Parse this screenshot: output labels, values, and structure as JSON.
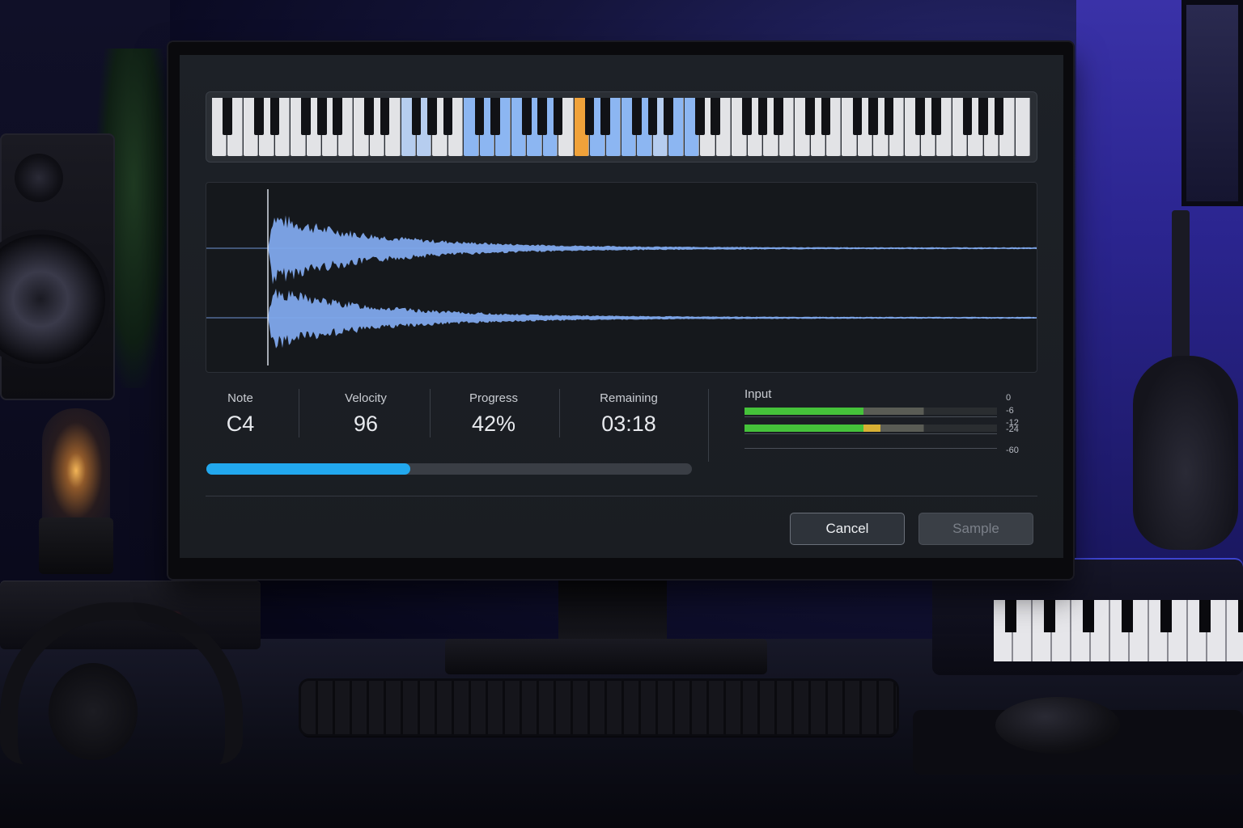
{
  "piano": {
    "white_key_count": 52,
    "highlighted_white_keys": [
      16,
      17,
      18,
      19,
      20,
      21,
      24,
      25,
      26,
      27,
      29,
      30
    ],
    "faded_white_keys": [
      12,
      13,
      28
    ],
    "active_white_key": 23,
    "colors": {
      "highlight": "#8cb6f2",
      "active": "#f0a23a",
      "white": "#e2e3e6",
      "black": "#111216"
    }
  },
  "waveform": {
    "color": "#7fa8ec",
    "channels": 2
  },
  "stats": {
    "note": {
      "label": "Note",
      "value": "C4"
    },
    "velocity": {
      "label": "Velocity",
      "value": "96"
    },
    "progress": {
      "label": "Progress",
      "value": "42%",
      "fraction": 0.42
    },
    "remaining": {
      "label": "Remaining",
      "value": "03:18"
    }
  },
  "meter": {
    "label": "Input",
    "scale": [
      "0",
      "-6",
      "-12",
      "-24",
      "-60"
    ],
    "channels": [
      {
        "level": 0.47,
        "peak": 0.71
      },
      {
        "level": 0.47,
        "hot": 0.54,
        "peak": 0.71
      }
    ],
    "colors": {
      "green": "#45c23a",
      "yellow": "#d8b034"
    }
  },
  "actions": {
    "cancel_label": "Cancel",
    "sample_label": "Sample"
  }
}
